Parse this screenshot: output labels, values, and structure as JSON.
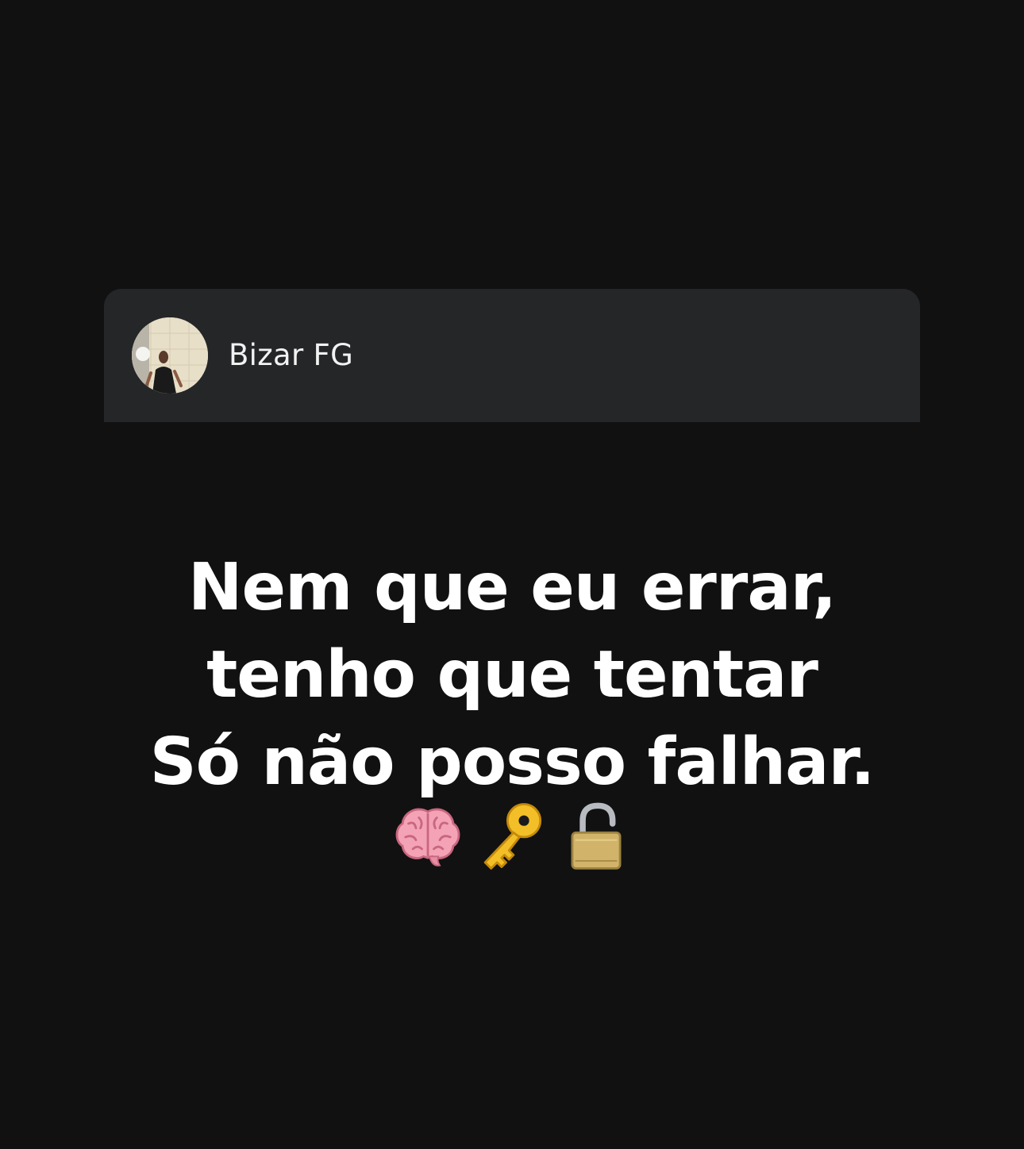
{
  "profile": {
    "username": "Bizar FG",
    "avatar": "profile-photo"
  },
  "quote": {
    "lines": [
      "Nem que eu errar,",
      "tenho que tentar",
      "Só não posso falhar."
    ]
  },
  "emojis": [
    "brain-icon",
    "key-icon",
    "open-lock-icon"
  ],
  "colors": {
    "background": "#111112",
    "card": "#242628",
    "text": "#ffffff",
    "username": "#f2f2f2"
  }
}
